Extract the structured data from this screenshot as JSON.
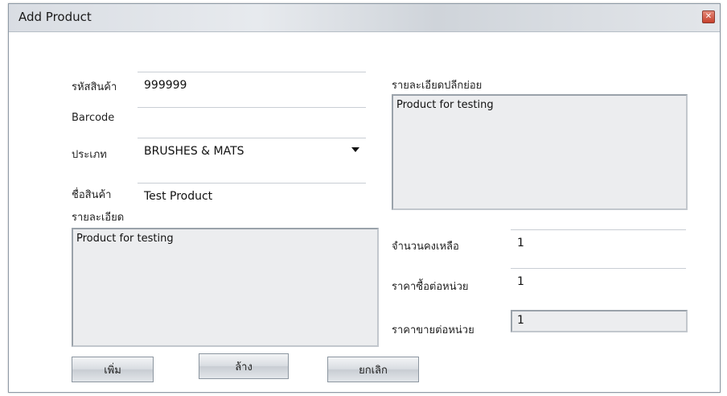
{
  "window": {
    "title": "Add Product",
    "close_glyph": "✕"
  },
  "form": {
    "product_code": {
      "label": "รหัสสินค้า",
      "value": "999999"
    },
    "barcode": {
      "label": "Barcode",
      "value": ""
    },
    "category": {
      "label": "ประเภท",
      "value": "BRUSHES & MATS"
    },
    "product_name": {
      "label": "ชื่อสินค้า",
      "value": "Test Product"
    },
    "description": {
      "label": "รายละเอียด",
      "value": "Product for testing"
    },
    "retail_detail": {
      "label": "รายละเอียดปลีกย่อย",
      "value": "Product for testing"
    },
    "stock": {
      "label": "จำนวนคงเหลือ",
      "value": "1"
    },
    "buy_price": {
      "label": "ราคาซื้อต่อหน่วย",
      "value": "1"
    },
    "sell_price": {
      "label": "ราคาขายต่อหน่วย",
      "value": "1"
    }
  },
  "buttons": {
    "add": "เพิ่ม",
    "clear": "ล้าง",
    "cancel": "ยกเลิก"
  },
  "icons": {
    "close": "close-icon",
    "dropdown": "chevron-down-icon"
  }
}
